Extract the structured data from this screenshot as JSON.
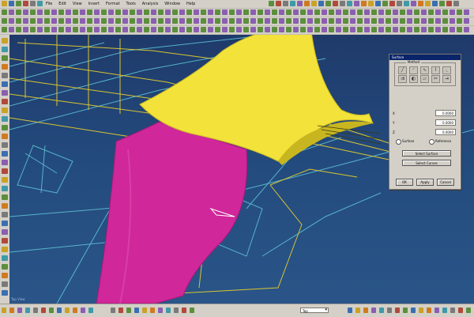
{
  "menubar": {
    "items": [
      "File",
      "Edit",
      "View",
      "Insert",
      "Format",
      "Tools",
      "Analysis",
      "Window",
      "Help"
    ]
  },
  "viewport": {
    "view_label": "Top View",
    "colors": {
      "background": "#234a7d",
      "yellow_surface": "#f2e23a",
      "magenta_surface": "#d0279a",
      "wireframe_yellow": "#d8c530",
      "wireframe_cyan": "#5fc6d8"
    }
  },
  "dialog": {
    "title": "Surface",
    "group_label": "Method",
    "method_icons": [
      "line-tool-icon",
      "arc-tool-icon",
      "curve-tool-icon",
      "spline-tool-icon",
      "fillet-tool-icon",
      "offset-tool-icon",
      "blend-tool-icon",
      "loft-tool-icon",
      "trim-tool-icon",
      "extend-tool-icon"
    ],
    "fields": [
      {
        "label": "X",
        "value": "0.0000"
      },
      {
        "label": "Y",
        "value": "0.0000"
      },
      {
        "label": "Z",
        "value": "0.0000"
      }
    ],
    "radios": [
      "Surface",
      "Reference"
    ],
    "wide_buttons": [
      "Select Surface",
      "Select Curves"
    ],
    "buttons": {
      "ok": "OK",
      "apply": "Apply",
      "cancel": "Cancel"
    }
  },
  "statusbar": {
    "select_value": "Top"
  }
}
